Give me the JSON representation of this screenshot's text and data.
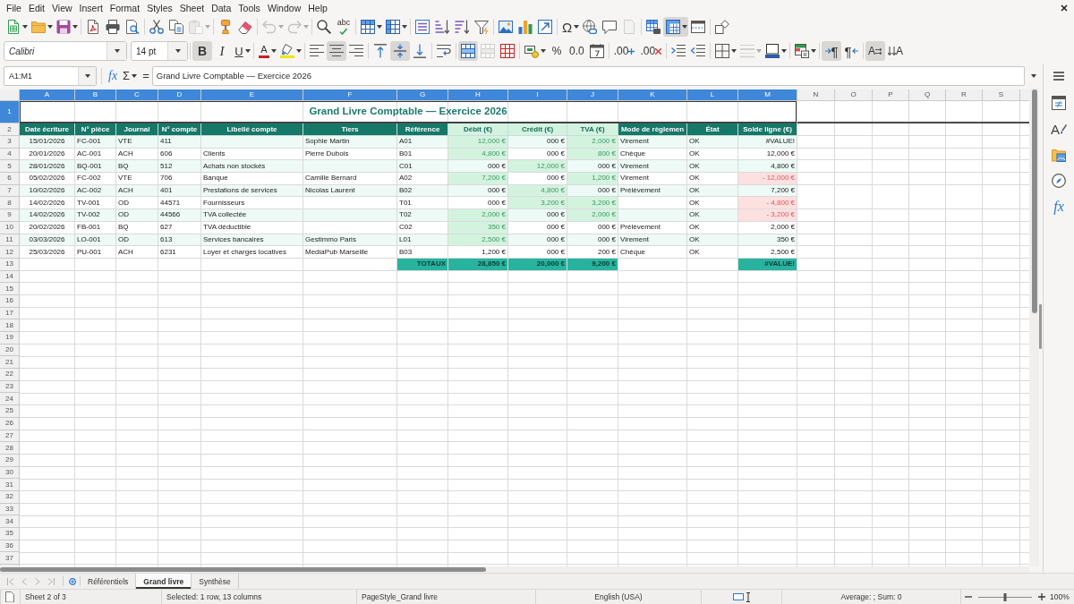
{
  "menu_bar": {
    "items": [
      "File",
      "Edit",
      "View",
      "Insert",
      "Format",
      "Styles",
      "Sheet",
      "Data",
      "Tools",
      "Window",
      "Help"
    ]
  },
  "standard_toolbar": {
    "groups": [
      [
        {
          "kind": "new",
          "pressed": false,
          "disabled": false
        },
        {
          "kind": "open",
          "pressed": false,
          "disabled": false
        },
        {
          "kind": "save",
          "pressed": false,
          "disabled": false
        }
      ],
      [
        {
          "kind": "export_pdf",
          "pressed": false,
          "disabled": false
        },
        {
          "kind": "print",
          "pressed": false,
          "disabled": false
        },
        {
          "kind": "print_preview",
          "pressed": false,
          "disabled": false
        }
      ],
      [
        {
          "kind": "cut",
          "pressed": false,
          "disabled": false
        },
        {
          "kind": "copy",
          "pressed": false,
          "disabled": false
        },
        {
          "kind": "paste",
          "pressed": false,
          "disabled": true
        }
      ],
      [
        {
          "kind": "clone_formatting",
          "pressed": false,
          "disabled": false
        },
        {
          "kind": "clear_formatting",
          "pressed": false,
          "disabled": false
        }
      ],
      [
        {
          "kind": "undo",
          "pressed": false,
          "disabled": true
        },
        {
          "kind": "redo",
          "pressed": false,
          "disabled": true
        }
      ],
      [
        {
          "kind": "find_replace",
          "pressed": false,
          "disabled": false
        },
        {
          "kind": "spelling",
          "glyph": "abc",
          "pressed": false,
          "disabled": false
        }
      ],
      [
        {
          "kind": "rows",
          "pressed": false,
          "disabled": false
        },
        {
          "kind": "columns",
          "pressed": false,
          "disabled": false
        }
      ],
      [
        {
          "kind": "sort",
          "pressed": false,
          "disabled": false
        },
        {
          "kind": "sort_ascending",
          "pressed": false,
          "disabled": false
        },
        {
          "kind": "sort_descending",
          "pressed": false,
          "disabled": false
        },
        {
          "kind": "autofilter",
          "pressed": false,
          "disabled": false
        }
      ],
      [
        {
          "kind": "image",
          "pressed": false,
          "disabled": false
        },
        {
          "kind": "chart",
          "pressed": false,
          "disabled": false
        },
        {
          "kind": "pivot_table",
          "pressed": false,
          "disabled": false
        }
      ],
      [
        {
          "kind": "special_character",
          "glyph": "Ω",
          "pressed": false,
          "disabled": false
        },
        {
          "kind": "hyperlink",
          "pressed": false,
          "disabled": false
        },
        {
          "kind": "comment",
          "pressed": false,
          "disabled": false
        },
        {
          "kind": "headers_footers",
          "pressed": false,
          "disabled": true
        }
      ],
      [
        {
          "kind": "print_area",
          "pressed": false,
          "disabled": false
        },
        {
          "kind": "freeze",
          "pressed": true,
          "disabled": false
        },
        {
          "kind": "split_window",
          "pressed": false,
          "disabled": false
        }
      ],
      [
        {
          "kind": "shapes",
          "pressed": false,
          "disabled": false
        }
      ]
    ]
  },
  "formatting_toolbar": {
    "font_name": "Calibri",
    "font_size": "14 pt",
    "groups": [
      [
        {
          "kind": "bold",
          "glyph": "B",
          "pressed": true,
          "disabled": false
        },
        {
          "kind": "italic",
          "glyph": "I",
          "pressed": false,
          "disabled": false
        },
        {
          "kind": "underline",
          "glyph": "U",
          "pressed": false,
          "disabled": false
        }
      ],
      [
        {
          "kind": "font_color",
          "glyph": "A",
          "pressed": false,
          "disabled": false
        },
        {
          "kind": "highlight",
          "pressed": false,
          "disabled": false
        }
      ],
      [
        {
          "kind": "align_left",
          "pressed": false,
          "disabled": false
        },
        {
          "kind": "align_center",
          "pressed": true,
          "disabled": false
        },
        {
          "kind": "align_right",
          "pressed": false,
          "disabled": false
        }
      ],
      [
        {
          "kind": "align_top",
          "pressed": false,
          "disabled": false
        },
        {
          "kind": "align_middle",
          "pressed": true,
          "disabled": false
        },
        {
          "kind": "align_bottom",
          "pressed": false,
          "disabled": false
        }
      ],
      [
        {
          "kind": "wrap_text",
          "pressed": false,
          "disabled": false
        }
      ],
      [
        {
          "kind": "merge_center",
          "pressed": true,
          "disabled": false
        },
        {
          "kind": "merge_cells",
          "pressed": false,
          "disabled": true
        },
        {
          "kind": "unmerge_cells",
          "pressed": false,
          "disabled": false
        }
      ],
      [
        {
          "kind": "currency",
          "pressed": false,
          "disabled": false
        },
        {
          "kind": "percent",
          "glyph": "%",
          "pressed": false,
          "disabled": false
        },
        {
          "kind": "number",
          "glyph": "0.0",
          "pressed": false,
          "disabled": false
        },
        {
          "kind": "date",
          "pressed": false,
          "disabled": false
        }
      ],
      [
        {
          "kind": "add_decimal",
          "glyph": ".00",
          "pressed": false,
          "disabled": false
        },
        {
          "kind": "delete_decimal",
          "glyph": ".00",
          "pressed": false,
          "disabled": false
        }
      ],
      [
        {
          "kind": "increase_indent",
          "pressed": false,
          "disabled": false
        },
        {
          "kind": "decrease_indent",
          "pressed": false,
          "disabled": false
        }
      ],
      [
        {
          "kind": "borders",
          "pressed": false,
          "disabled": false
        },
        {
          "kind": "border_style",
          "pressed": false,
          "disabled": true
        },
        {
          "kind": "border_color",
          "pressed": false,
          "disabled": false
        }
      ],
      [
        {
          "kind": "conditional",
          "pressed": false,
          "disabled": false
        }
      ],
      [
        {
          "kind": "left_to_right",
          "glyph": "¶",
          "pressed": true,
          "disabled": false
        },
        {
          "kind": "right_to_left",
          "glyph": "¶",
          "pressed": false,
          "disabled": false
        }
      ],
      [
        {
          "kind": "text_direction",
          "glyph": "A",
          "pressed": true,
          "disabled": false
        },
        {
          "kind": "stacked_text",
          "glyph": "A",
          "pressed": false,
          "disabled": false
        }
      ]
    ]
  },
  "formula_bar": {
    "name_box": "A1:M1",
    "function_wizard": "fx",
    "sum": "Σ",
    "equals": "=",
    "content": "Grand Livre Comptable — Exercice 2026"
  },
  "sheet": {
    "columns": [
      {
        "label": "A",
        "selected": true
      },
      {
        "label": "B",
        "selected": true
      },
      {
        "label": "C",
        "selected": true
      },
      {
        "label": "D",
        "selected": true
      },
      {
        "label": "E",
        "selected": true
      },
      {
        "label": "F",
        "selected": true
      },
      {
        "label": "G",
        "selected": true
      },
      {
        "label": "H",
        "selected": true
      },
      {
        "label": "I",
        "selected": true
      },
      {
        "label": "J",
        "selected": true
      },
      {
        "label": "K",
        "selected": true
      },
      {
        "label": "L",
        "selected": true
      },
      {
        "label": "M",
        "selected": true
      },
      {
        "label": "N",
        "selected": false
      },
      {
        "label": "O",
        "selected": false
      },
      {
        "label": "P",
        "selected": false
      },
      {
        "label": "Q",
        "selected": false
      },
      {
        "label": "R",
        "selected": false
      },
      {
        "label": "S",
        "selected": false
      }
    ],
    "rows": [
      {
        "label": "1",
        "selected": true
      },
      {
        "label": "2",
        "selected": false
      },
      {
        "label": "3",
        "selected": false
      },
      {
        "label": "4",
        "selected": false
      },
      {
        "label": "5",
        "selected": false
      },
      {
        "label": "6",
        "selected": false
      },
      {
        "label": "7",
        "selected": false
      },
      {
        "label": "8",
        "selected": false
      },
      {
        "label": "9",
        "selected": false
      },
      {
        "label": "10",
        "selected": false
      },
      {
        "label": "11",
        "selected": false
      },
      {
        "label": "12",
        "selected": false
      },
      {
        "label": "13",
        "selected": false
      },
      {
        "label": "14",
        "selected": false
      },
      {
        "label": "15",
        "selected": false
      },
      {
        "label": "16",
        "selected": false
      },
      {
        "label": "17",
        "selected": false
      },
      {
        "label": "18",
        "selected": false
      },
      {
        "label": "19",
        "selected": false
      },
      {
        "label": "20",
        "selected": false
      },
      {
        "label": "21",
        "selected": false
      },
      {
        "label": "22",
        "selected": false
      },
      {
        "label": "23",
        "selected": false
      },
      {
        "label": "24",
        "selected": false
      },
      {
        "label": "25",
        "selected": false
      },
      {
        "label": "26",
        "selected": false
      },
      {
        "label": "27",
        "selected": false
      },
      {
        "label": "28",
        "selected": false
      },
      {
        "label": "29",
        "selected": false
      },
      {
        "label": "30",
        "selected": false
      },
      {
        "label": "31",
        "selected": false
      },
      {
        "label": "32",
        "selected": false
      },
      {
        "label": "33",
        "selected": false
      },
      {
        "label": "34",
        "selected": false
      },
      {
        "label": "35",
        "selected": false
      },
      {
        "label": "36",
        "selected": false
      },
      {
        "label": "37",
        "selected": false
      }
    ],
    "freeze": true,
    "title": {
      "text": "Grand Livre Comptable — Exercice 2026",
      "selected": true
    },
    "header": [
      {
        "text": "Date écriture",
        "highlighted": false
      },
      {
        "text": "N° pièce",
        "highlighted": false
      },
      {
        "text": "Journal",
        "highlighted": false
      },
      {
        "text": "N° compte",
        "highlighted": false
      },
      {
        "text": "Libellé compte",
        "highlighted": false
      },
      {
        "text": "Tiers",
        "highlighted": false
      },
      {
        "text": "Référence",
        "highlighted": false
      },
      {
        "text": "Débit (€)",
        "highlighted": true
      },
      {
        "text": "Crédit (€)",
        "highlighted": true
      },
      {
        "text": "TVA (€)",
        "highlighted": true
      },
      {
        "text": "Mode de règlemen",
        "highlighted": false
      },
      {
        "text": "État",
        "highlighted": false
      },
      {
        "text": "Solde ligne (€)",
        "highlighted": false
      }
    ],
    "entries": [
      {
        "date": "15/01/2026",
        "piece": "FC-001",
        "journal": "VTE",
        "account": "411",
        "third_party": "Sophie Martin",
        "reference": "A01",
        "debit": {
          "text": "12,000 €",
          "highlighted": true
        },
        "credit": {
          "text": "000 €",
          "highlighted": false
        },
        "vat": {
          "text": "2,000 €",
          "highlighted": true
        },
        "payment": "Virement",
        "status": "OK",
        "balance": {
          "text": "#VALUE!",
          "negative": false
        }
      },
      {
        "date": "20/01/2026",
        "piece": "AC-001",
        "journal": "ACH",
        "account": "606",
        "account_label": "Clients",
        "third_party": "Pierre Dubois",
        "reference": "B01",
        "debit": {
          "text": "4,800 €",
          "highlighted": true
        },
        "credit": {
          "text": "000 €",
          "highlighted": false
        },
        "vat": {
          "text": "800 €",
          "highlighted": true
        },
        "payment": "Chèque",
        "status": "OK",
        "balance": {
          "text": "12,000 €",
          "negative": false
        }
      },
      {
        "date": "28/01/2026",
        "piece": "BQ-001",
        "journal": "BQ",
        "account": "512",
        "account_label": "Achats non stockés",
        "reference": "C01",
        "debit": {
          "text": "000 €",
          "highlighted": false
        },
        "credit": {
          "text": "12,000 €",
          "highlighted": true
        },
        "vat": {
          "text": "000 €",
          "highlighted": false
        },
        "payment": "Virement",
        "status": "OK",
        "balance": {
          "text": "4,800 €",
          "negative": false
        }
      },
      {
        "date": "05/02/2026",
        "piece": "FC-002",
        "journal": "VTE",
        "account": "706",
        "account_label": "Banque",
        "third_party": "Camille Bernard",
        "reference": "A02",
        "debit": {
          "text": "7,200 €",
          "highlighted": true
        },
        "credit": {
          "text": "000 €",
          "highlighted": false
        },
        "vat": {
          "text": "1,200 €",
          "highlighted": true
        },
        "payment": "Virement",
        "status": "OK",
        "balance": {
          "text": "- 12,000 €",
          "negative": true
        }
      },
      {
        "date": "10/02/2026",
        "piece": "AC-002",
        "journal": "ACH",
        "account": "401",
        "account_label": "Prestations de services",
        "third_party": "Nicolas Laurent",
        "reference": "B02",
        "debit": {
          "text": "000 €",
          "highlighted": false
        },
        "credit": {
          "text": "4,800 €",
          "highlighted": true
        },
        "vat": {
          "text": "000 €",
          "highlighted": false
        },
        "payment": "Prélèvement",
        "status": "OK",
        "balance": {
          "text": "7,200 €",
          "negative": false
        }
      },
      {
        "date": "14/02/2026",
        "piece": "TV-001",
        "journal": "OD",
        "account": "44571",
        "account_label": "Fournisseurs",
        "reference": "T01",
        "debit": {
          "text": "000 €",
          "highlighted": false
        },
        "credit": {
          "text": "3,200 €",
          "highlighted": true
        },
        "vat": {
          "text": "3,200 €",
          "highlighted": true
        },
        "status": "OK",
        "balance": {
          "text": "- 4,800 €",
          "negative": true
        }
      },
      {
        "date": "14/02/2026",
        "piece": "TV-002",
        "journal": "OD",
        "account": "44566",
        "account_label": "TVA collectée",
        "reference": "T02",
        "debit": {
          "text": "2,000 €",
          "highlighted": true
        },
        "credit": {
          "text": "000 €",
          "highlighted": false
        },
        "vat": {
          "text": "2,000 €",
          "highlighted": true
        },
        "status": "OK",
        "balance": {
          "text": "- 3,200 €",
          "negative": true
        }
      },
      {
        "date": "20/02/2026",
        "piece": "FB-001",
        "journal": "BQ",
        "account": "627",
        "account_label": "TVA déductible",
        "reference": "C02",
        "debit": {
          "text": "350 €",
          "highlighted": true
        },
        "credit": {
          "text": "000 €",
          "highlighted": false
        },
        "vat": {
          "text": "000 €",
          "highlighted": false
        },
        "payment": "Prélèvement",
        "status": "OK",
        "balance": {
          "text": "2,000 €",
          "negative": false
        }
      },
      {
        "date": "03/03/2026",
        "piece": "LO-001",
        "journal": "OD",
        "account": "613",
        "account_label": "Services bancaires",
        "third_party": "Gestimmo Paris",
        "reference": "L01",
        "debit": {
          "text": "2,500 €",
          "highlighted": true
        },
        "credit": {
          "text": "000 €",
          "highlighted": false
        },
        "vat": {
          "text": "000 €",
          "highlighted": false
        },
        "payment": "Virement",
        "status": "OK",
        "balance": {
          "text": "350 €",
          "negative": false
        }
      },
      {
        "date": "25/03/2026",
        "piece": "PU-001",
        "journal": "ACH",
        "account": "6231",
        "account_label": "Loyer et charges locatives",
        "third_party": "MediaPub Marseille",
        "reference": "B03",
        "debit": {
          "text": "1,200 €",
          "highlighted": false
        },
        "credit": {
          "text": "000 €",
          "highlighted": false
        },
        "vat": {
          "text": "200 €",
          "highlighted": false
        },
        "payment": "Chèque",
        "status": "OK",
        "balance": {
          "text": "2,500 €",
          "negative": false
        }
      }
    ],
    "totals": {
      "label": "TOTAUX",
      "debit": "28,850 €",
      "credit": "20,000 €",
      "vat": "9,200 €",
      "balance": "#VALUE!"
    }
  },
  "sidebar": {
    "tabs": [
      {
        "kind": "properties",
        "selected": false
      },
      {
        "kind": "styles",
        "glyph": "A",
        "selected": false
      },
      {
        "kind": "gallery",
        "selected": false
      },
      {
        "kind": "navigator",
        "selected": false
      },
      {
        "kind": "functions",
        "glyph": "fx",
        "selected": false
      }
    ]
  },
  "sheet_tabs": {
    "navigation": [
      {
        "kind": "first",
        "disabled": true
      },
      {
        "kind": "previous",
        "disabled": true
      },
      {
        "kind": "next",
        "disabled": true
      },
      {
        "kind": "last",
        "disabled": true
      }
    ],
    "tabs": [
      {
        "label": "Référentiels",
        "selected": false
      },
      {
        "label": "Grand livre",
        "selected": true
      },
      {
        "label": "Synthèse",
        "selected": false
      }
    ]
  },
  "status_bar": {
    "sheet_position": "Sheet 2 of 3",
    "selection": "Selected: 1 row, 13 columns",
    "page_style": "PageStyle_Grand livre",
    "language": "English (USA)",
    "summary": "Average: ; Sum: 0",
    "zoom": {
      "level": 0.5,
      "reading": "100%"
    }
  }
}
